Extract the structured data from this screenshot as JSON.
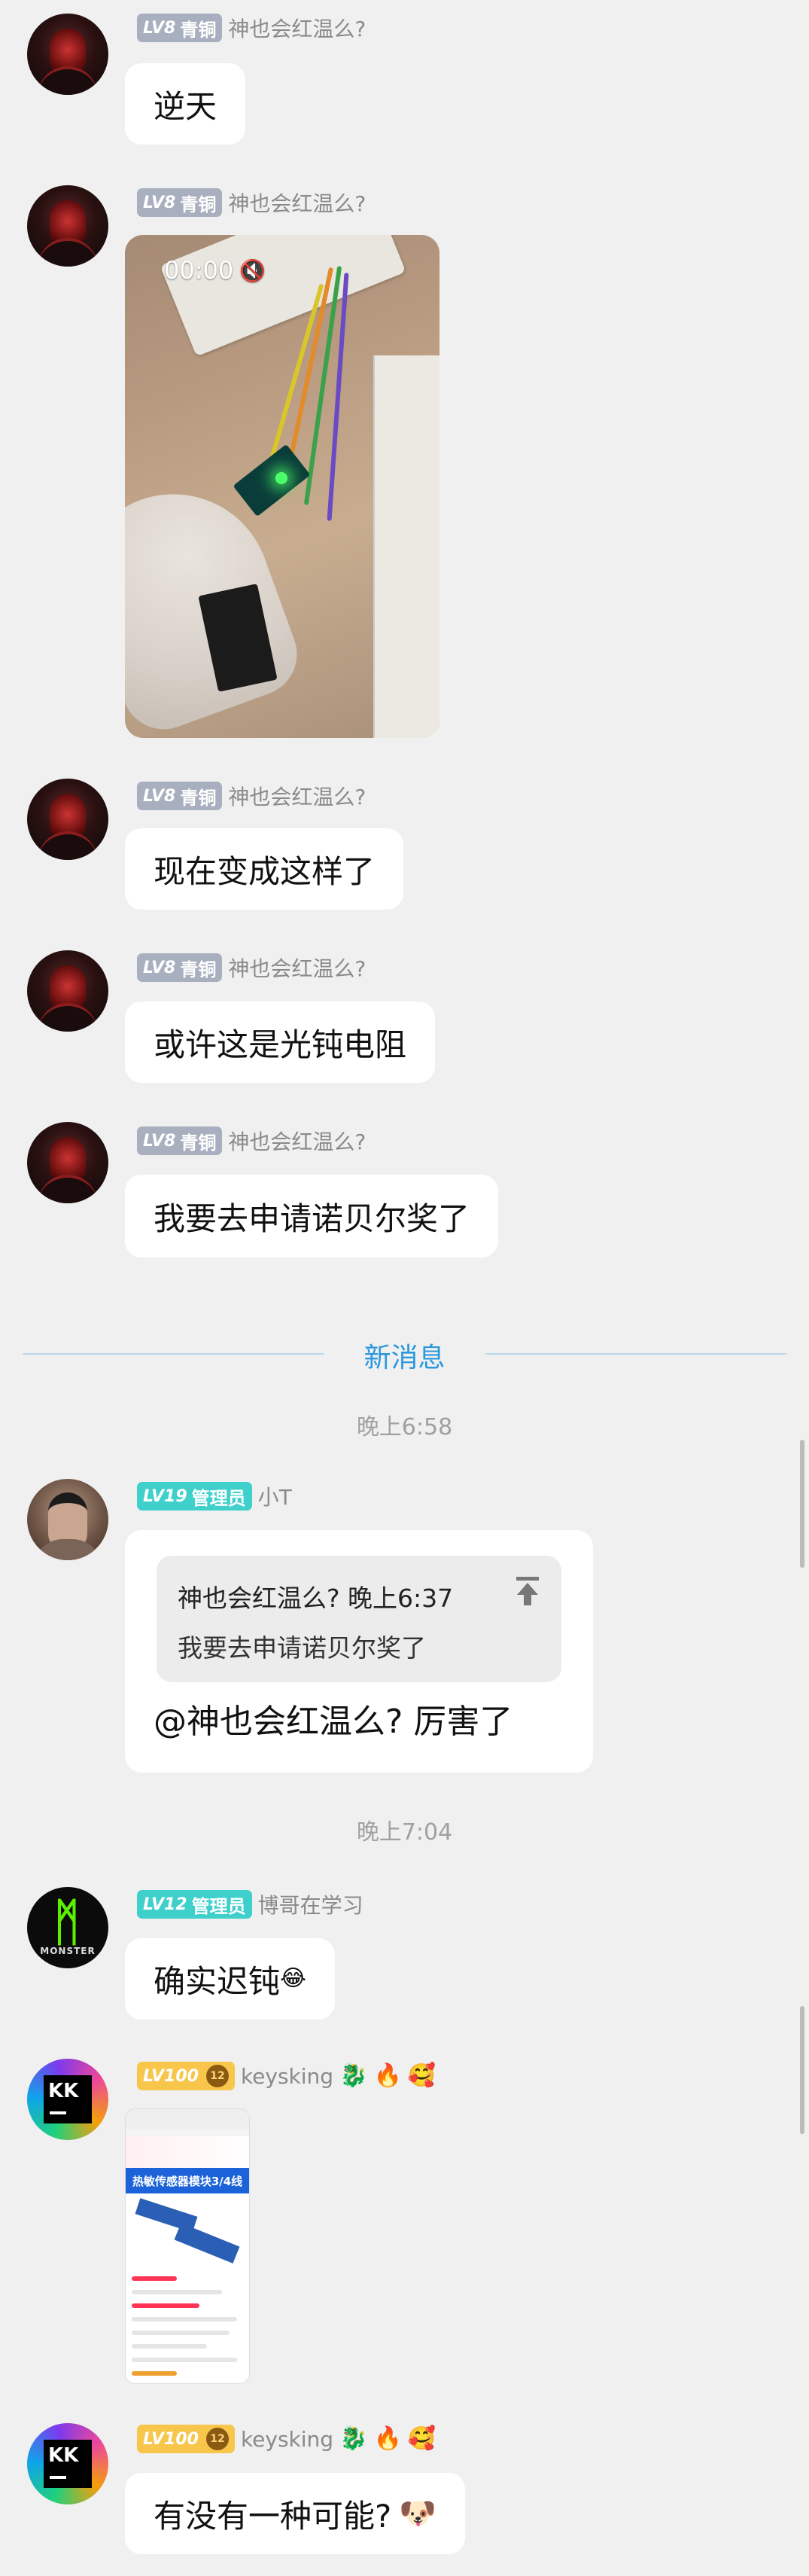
{
  "users": {
    "shen": {
      "level": "LV8",
      "title": "青铜",
      "name": "神也会红温么?"
    },
    "xiaot": {
      "level": "LV19",
      "title": "管理员",
      "name": "小T"
    },
    "bo": {
      "level": "LV12",
      "title": "管理员",
      "name": "博哥在学习"
    },
    "keys": {
      "level": "LV100",
      "name": "keysking",
      "crest": "12",
      "emojis": [
        "🐉",
        "🔥",
        "🥰"
      ]
    }
  },
  "messages": {
    "m1": "逆天",
    "video_time": "00:00",
    "m3": "现在变成这样了",
    "m4": "或许这是光钝电阻",
    "m5": "我要去申请诺贝尔奖了",
    "reply_quote_head": "神也会红温么?  晚上6:37",
    "reply_quote_text": "我要去申请诺贝尔奖了",
    "reply_text": "@神也会红温么?  厉害了",
    "m7": "确实迟钝",
    "m7_emoji": "😂",
    "m9": "有没有一种可能?",
    "m9_emoji": "🐶"
  },
  "divider": {
    "new_messages": "新消息"
  },
  "times": {
    "t1": "晚上6:58",
    "t2": "晚上7:04"
  },
  "product_image": {
    "banner": "热敏传感器模块3/4线"
  },
  "avatar_labels": {
    "kk": "KK",
    "monster": "MONSTER"
  }
}
